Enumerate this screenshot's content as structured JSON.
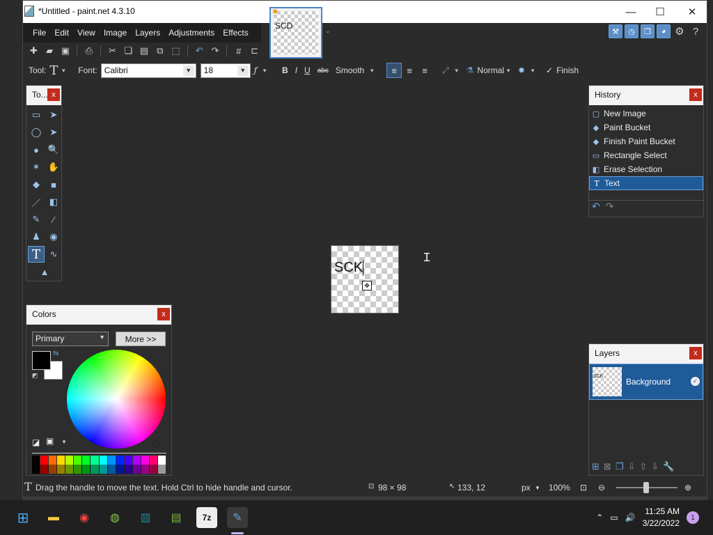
{
  "window": {
    "title": "*Untitled - paint.net 4.3.10",
    "minimize": "—",
    "maximize": "☐",
    "close": "✕"
  },
  "menu": [
    "File",
    "Edit",
    "View",
    "Image",
    "Layers",
    "Adjustments",
    "Effects"
  ],
  "thumbnail": {
    "text": "SCD",
    "arrow": "⌄"
  },
  "toolbar_options": {
    "tool_label": "Tool:",
    "tool_icon": "T",
    "font_label": "Font:",
    "font_value": "Calibri",
    "size_value": "18",
    "bold": "B",
    "italic": "I",
    "underline": "U",
    "strike": "abc",
    "antialias": "Smooth",
    "blend": "Normal",
    "finish": "Finish"
  },
  "tools_panel": {
    "title": "To...",
    "close": "x"
  },
  "tools": [
    {
      "name": "rectangle-select-tool",
      "glyph": "▭"
    },
    {
      "name": "move-selected-tool",
      "glyph": "➤"
    },
    {
      "name": "lasso-select-tool",
      "glyph": "◯"
    },
    {
      "name": "move-selection-tool",
      "glyph": "➤"
    },
    {
      "name": "ellipse-select-tool",
      "glyph": "●"
    },
    {
      "name": "zoom-tool",
      "glyph": "🔍"
    },
    {
      "name": "magic-wand-tool",
      "glyph": "✶"
    },
    {
      "name": "pan-tool",
      "glyph": "✋"
    },
    {
      "name": "paint-bucket-tool",
      "glyph": "◆"
    },
    {
      "name": "gradient-tool",
      "glyph": "■"
    },
    {
      "name": "paintbrush-tool",
      "glyph": "／"
    },
    {
      "name": "eraser-tool",
      "glyph": "◧"
    },
    {
      "name": "pencil-tool",
      "glyph": "✎"
    },
    {
      "name": "color-picker-tool",
      "glyph": "⁄"
    },
    {
      "name": "clone-stamp-tool",
      "glyph": "♟"
    },
    {
      "name": "recolor-tool",
      "glyph": "◉"
    },
    {
      "name": "text-tool",
      "glyph": "T"
    },
    {
      "name": "line-curve-tool",
      "glyph": "∿"
    },
    {
      "name": "shapes-tool",
      "glyph": "▲"
    }
  ],
  "colors_panel": {
    "title": "Colors",
    "close": "x",
    "primary_select": "Primary",
    "more_button": "More >>",
    "palette": [
      "#000000",
      "#ff0000",
      "#ff6a00",
      "#ffd800",
      "#b6ff00",
      "#4cff00",
      "#00ff21",
      "#00ff90",
      "#00ffff",
      "#0094ff",
      "#0026ff",
      "#4800ff",
      "#b200ff",
      "#ff00dc",
      "#ff006e",
      "#ffffff"
    ]
  },
  "history_panel": {
    "title": "History",
    "close": "x",
    "items": [
      "New Image",
      "Paint Bucket",
      "Finish Paint Bucket",
      "Rectangle Select",
      "Erase Selection",
      "Text"
    ]
  },
  "layers_panel": {
    "title": "Layers",
    "close": "x",
    "layer_name": "Background",
    "thumb_text": "SCK"
  },
  "canvas": {
    "text": "SCK"
  },
  "status": {
    "hint": "Drag the handle to move the text. Hold Ctrl to hide handle and cursor.",
    "size": "98 × 98",
    "position": "133, 12",
    "unit": "px",
    "zoom": "100%"
  },
  "taskbar": {
    "time": "11:25 AM",
    "date": "3/22/2022",
    "notifications": "1"
  }
}
